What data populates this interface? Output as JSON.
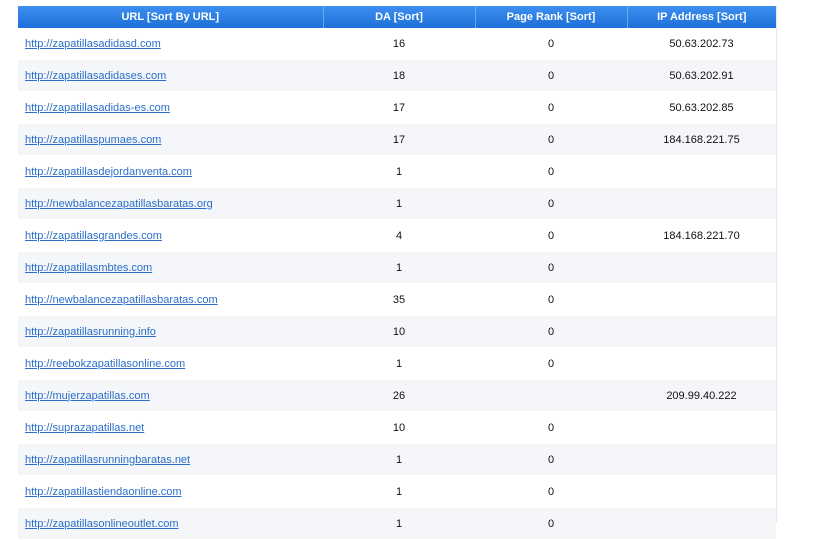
{
  "headers": {
    "url": "URL [Sort By URL]",
    "da": "DA [Sort]",
    "page_rank": "Page Rank [Sort]",
    "ip": "IP Address [Sort]"
  },
  "rows": [
    {
      "url": "http://zapatillasadidasd.com",
      "da": "16",
      "pr": "0",
      "ip": "50.63.202.73"
    },
    {
      "url": "http://zapatillasadidases.com",
      "da": "18",
      "pr": "0",
      "ip": "50.63.202.91"
    },
    {
      "url": "http://zapatillasadidas-es.com",
      "da": "17",
      "pr": "0",
      "ip": "50.63.202.85"
    },
    {
      "url": "http://zapatillaspumaes.com",
      "da": "17",
      "pr": "0",
      "ip": "184.168.221.75"
    },
    {
      "url": "http://zapatillasdejordanventa.com",
      "da": "1",
      "pr": "0",
      "ip": ""
    },
    {
      "url": "http://newbalancezapatillasbaratas.org",
      "da": "1",
      "pr": "0",
      "ip": ""
    },
    {
      "url": "http://zapatillasgrandes.com",
      "da": "4",
      "pr": "0",
      "ip": "184.168.221.70"
    },
    {
      "url": "http://zapatillasmbtes.com",
      "da": "1",
      "pr": "0",
      "ip": ""
    },
    {
      "url": "http://newbalancezapatillasbaratas.com",
      "da": "35",
      "pr": "0",
      "ip": ""
    },
    {
      "url": "http://zapatillasrunning.info",
      "da": "10",
      "pr": "0",
      "ip": ""
    },
    {
      "url": "http://reebokzapatillasonline.com",
      "da": "1",
      "pr": "0",
      "ip": ""
    },
    {
      "url": "http://mujerzapatillas.com",
      "da": "26",
      "pr": "",
      "ip": "209.99.40.222"
    },
    {
      "url": "http://suprazapatillas.net",
      "da": "10",
      "pr": "0",
      "ip": ""
    },
    {
      "url": "http://zapatillasrunningbaratas.net",
      "da": "1",
      "pr": "0",
      "ip": ""
    },
    {
      "url": "http://zapatillastiendaonline.com",
      "da": "1",
      "pr": "0",
      "ip": ""
    },
    {
      "url": "http://zapatillasonlineoutlet.com",
      "da": "1",
      "pr": "0",
      "ip": ""
    }
  ]
}
